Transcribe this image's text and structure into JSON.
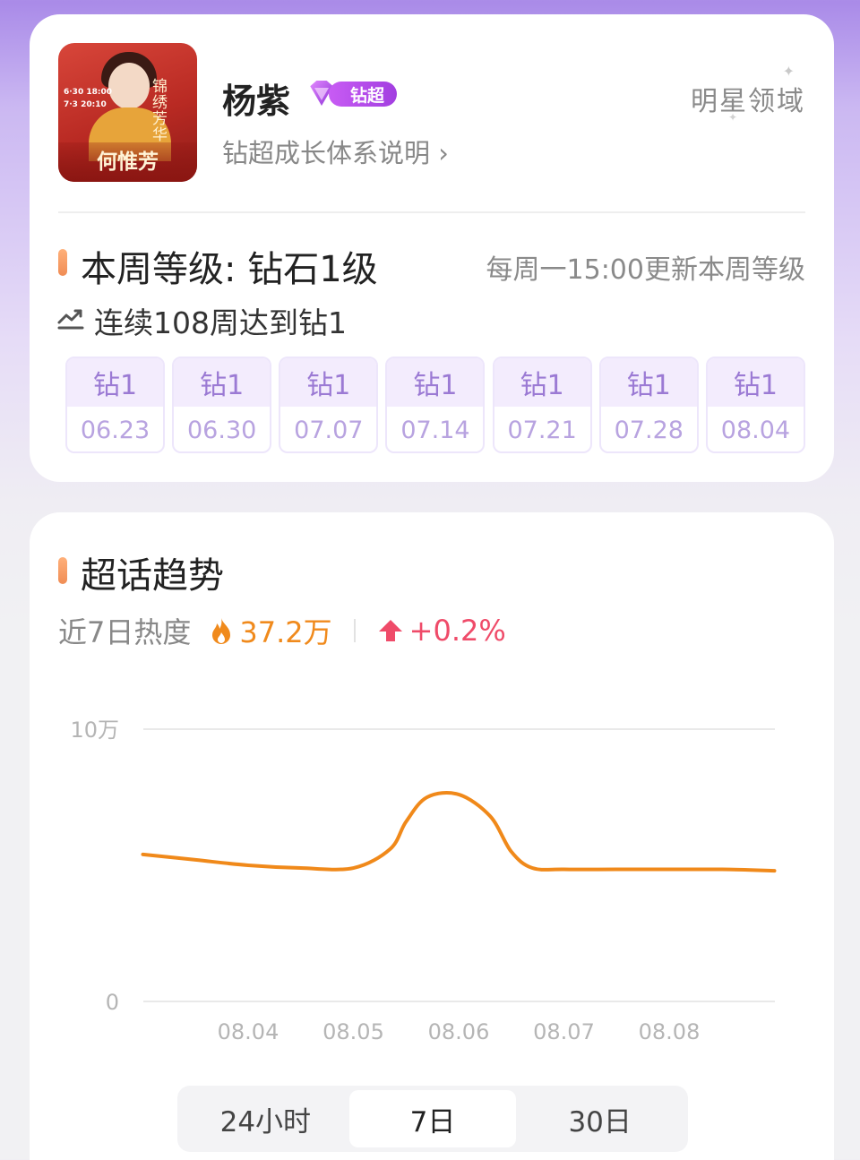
{
  "profile": {
    "name": "杨紫",
    "badge_label": "钻超",
    "growth_link": "钻超成长体系说明 ›",
    "domain": "明星领域",
    "poster": {
      "title": "何惟芳",
      "date_lines": [
        "6·30 18:00",
        "7·3 20:10"
      ],
      "calligraphy": "锦绣芳华"
    }
  },
  "level": {
    "title": "本周等级: 钻石1级",
    "update_note": "每周一15:00更新本周等级",
    "streak": "连续108周达到钻1",
    "weeks": [
      {
        "level": "钻1",
        "date": "06.23"
      },
      {
        "level": "钻1",
        "date": "06.30"
      },
      {
        "level": "钻1",
        "date": "07.07"
      },
      {
        "level": "钻1",
        "date": "07.14"
      },
      {
        "level": "钻1",
        "date": "07.21"
      },
      {
        "level": "钻1",
        "date": "07.28"
      },
      {
        "level": "钻1",
        "date": "08.04"
      }
    ]
  },
  "trend": {
    "title": "超话趋势",
    "heat_label": "近7日热度",
    "heat_value": "37.2万",
    "heat_change": "+0.2%",
    "range_tabs": [
      "24小时",
      "7日",
      "30日"
    ],
    "active_range": "7日"
  },
  "colors": {
    "accent_orange": "#f08a1c",
    "line": "#f0891a",
    "up_red": "#ef4b69",
    "badge_purple": "#a23ee0"
  },
  "chart_data": {
    "type": "line",
    "x_ticks": [
      "08.04",
      "08.05",
      "08.06",
      "08.07",
      "08.08"
    ],
    "y_ticks": [
      "10万",
      "0"
    ],
    "ylim": [
      0,
      10
    ],
    "y_unit": "万",
    "grid": true,
    "series": [
      {
        "x": [
          -1,
          -0.5,
          0,
          0.5,
          1.0,
          1.35,
          1.5,
          1.7,
          2.0,
          2.3,
          2.5,
          2.7,
          3.0,
          3.5,
          4.0,
          4.5,
          5.0
        ],
        "values": [
          5.4,
          5.2,
          5.0,
          4.9,
          4.9,
          5.6,
          6.6,
          7.5,
          7.6,
          6.8,
          5.5,
          4.9,
          4.85,
          4.85,
          4.85,
          4.85,
          4.8
        ]
      }
    ]
  }
}
